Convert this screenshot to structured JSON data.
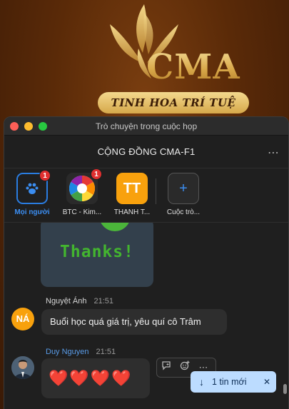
{
  "background": {
    "logo_text": "CMA",
    "tagline": "TINH HOA TRÍ TUỆ"
  },
  "window": {
    "title": "Trò chuyện trong cuộc họp"
  },
  "header": {
    "chat_name": "CỘNG ĐỒNG CMA-F1",
    "more_icon": "⋯"
  },
  "tabs": [
    {
      "label": "Mọi người",
      "badge": "1",
      "icon": "people-icon",
      "active": true
    },
    {
      "label": "BTC - Kim...",
      "badge": "1",
      "icon": "color-wheel-icon"
    },
    {
      "label": "THANH T...",
      "initials": "TT"
    },
    {
      "label": "Cuộc trò...",
      "icon": "plus-icon",
      "symbol": "+"
    }
  ],
  "messages": {
    "sticker_text": "Thanks!",
    "msg1": {
      "sender": "Nguyệt Ánh",
      "time": "21:51",
      "initials": "NÁ",
      "text": "Buổi học quá giá trị, yêu quí cô Trâm"
    },
    "msg2": {
      "sender": "Duy Nguyen",
      "time": "21:51",
      "text": "❤️❤️❤️❤️"
    }
  },
  "new_messages": {
    "label": "1 tin mới",
    "arrow": "↓",
    "close": "✕"
  },
  "colors": {
    "accent": "#2a7de1",
    "badge": "#e02f2f",
    "orange_avatar": "#f8a10d"
  }
}
